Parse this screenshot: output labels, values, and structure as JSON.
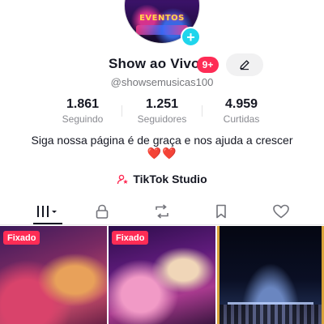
{
  "profile": {
    "display_name": "Show ao Vivo",
    "notification_badge": "9+",
    "username": "@showsemusicas100",
    "avatar_text": "EVENTOS"
  },
  "stats": [
    {
      "value": "1.861",
      "label": "Seguindo"
    },
    {
      "value": "1.251",
      "label": "Seguidores"
    },
    {
      "value": "4.959",
      "label": "Curtidas"
    }
  ],
  "bio": {
    "text": "Siga nossa página é de graça e nos ajuda a crescer",
    "emoji": "❤️❤️"
  },
  "studio": {
    "label": "TikTok Studio"
  },
  "tabs": [
    {
      "icon": "grid-icon",
      "active": true
    },
    {
      "icon": "lock-icon",
      "active": false
    },
    {
      "icon": "repost-icon",
      "active": false
    },
    {
      "icon": "bookmark-icon",
      "active": false
    },
    {
      "icon": "heart-icon",
      "active": false
    }
  ],
  "videos": [
    {
      "pinned_label": "Fixado"
    },
    {
      "pinned_label": "Fixado"
    },
    {
      "pinned_label": ""
    }
  ],
  "colors": {
    "accent": "#fe2c55",
    "plus_badge": "#20d5ec",
    "text_primary": "#161823",
    "text_secondary": "#75767b"
  }
}
